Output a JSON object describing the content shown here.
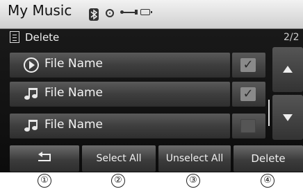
{
  "header": {
    "title": "My Music",
    "icons": [
      "bluetooth-icon",
      "disc-icon",
      "usb-icon",
      "battery-icon"
    ]
  },
  "subheader": {
    "mode_label": "Delete",
    "page_indicator": "2/2"
  },
  "files": [
    {
      "name": "File Name",
      "icon": "play-icon",
      "checked": true
    },
    {
      "name": "File Name",
      "icon": "music-note-icon",
      "checked": true
    },
    {
      "name": "File Name",
      "icon": "music-note-icon",
      "checked": false
    }
  ],
  "buttons": {
    "back": "back-icon",
    "select_all": "Select All",
    "unselect_all": "Unselect All",
    "delete": "Delete"
  },
  "callouts": [
    "①",
    "②",
    "③",
    "④"
  ],
  "colors": {
    "header_bg": "#e0e0e0",
    "screen_bg": "#141414",
    "row_bg": "#474747",
    "text": "#f4f4f4"
  }
}
